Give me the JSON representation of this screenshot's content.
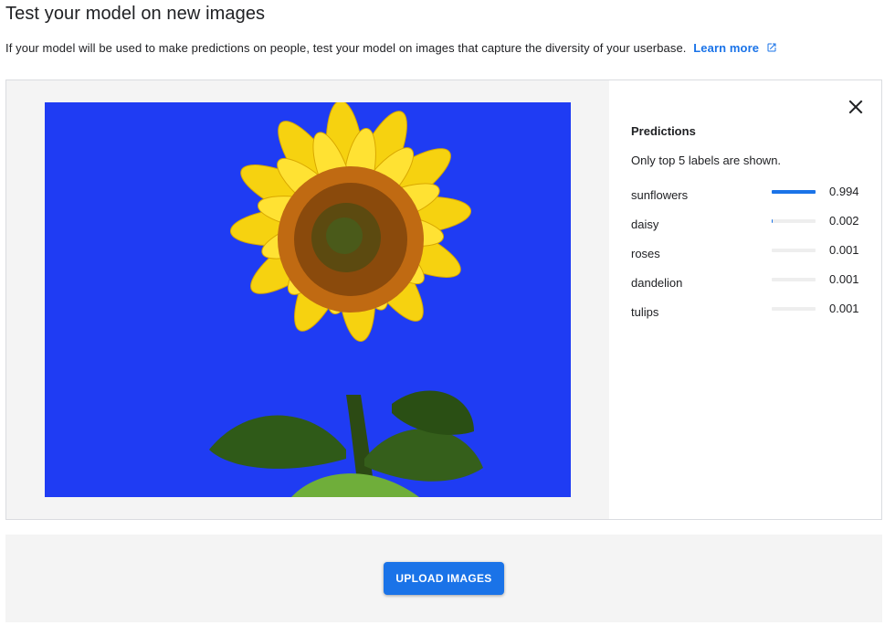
{
  "header": {
    "title": "Test your model on new images",
    "intro": "If your model will be used to make predictions on people, test your model on images that capture the diversity of your userbase.",
    "learn_more": "Learn more"
  },
  "predictions": {
    "title": "Predictions",
    "subtitle": "Only top 5 labels are shown.",
    "items": [
      {
        "label": "sunflowers",
        "score": "0.994",
        "value": 0.994
      },
      {
        "label": "daisy",
        "score": "0.002",
        "value": 0.002
      },
      {
        "label": "roses",
        "score": "0.001",
        "value": 0.001
      },
      {
        "label": "dandelion",
        "score": "0.001",
        "value": 0.001
      },
      {
        "label": "tulips",
        "score": "0.001",
        "value": 0.001
      }
    ]
  },
  "upload": {
    "button_label": "UPLOAD IMAGES"
  },
  "colors": {
    "accent": "#1a73e8",
    "track": "#eeeeee",
    "sky": "#1f3cf3"
  },
  "icons": {
    "close": "close-icon",
    "external": "open-in-new-icon"
  }
}
